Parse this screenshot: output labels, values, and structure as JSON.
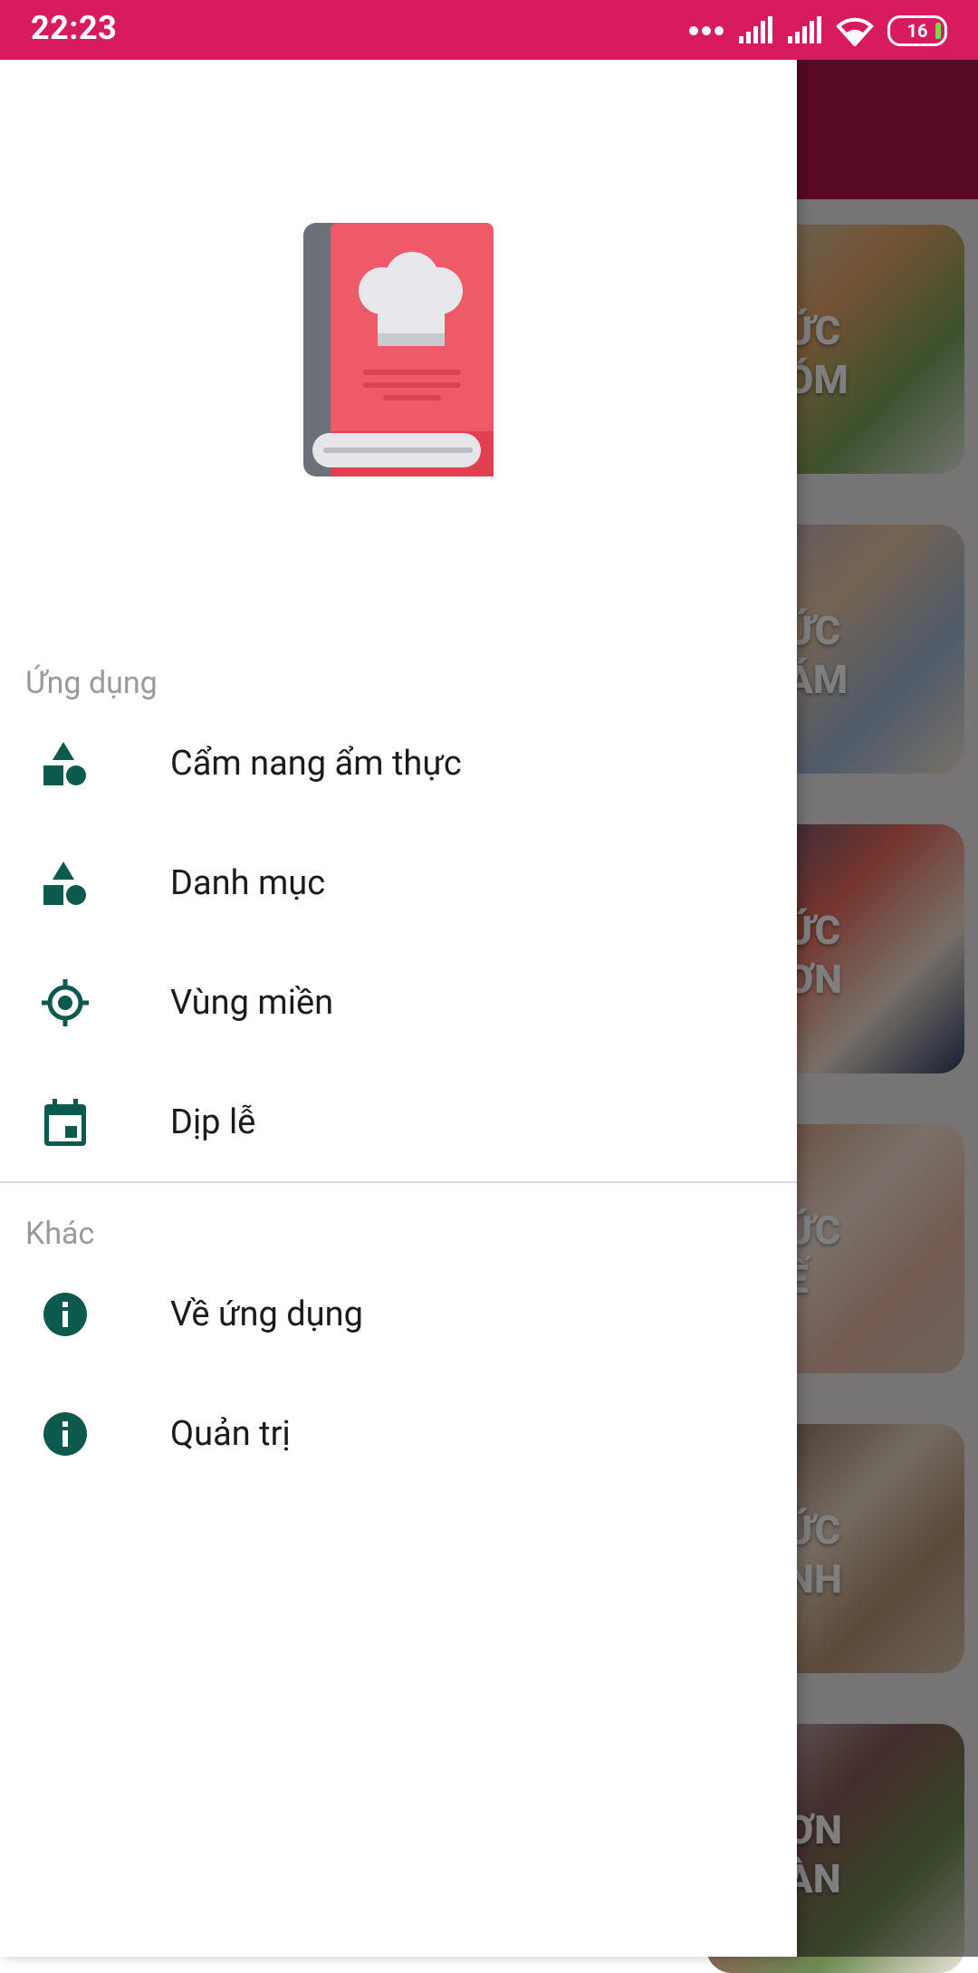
{
  "status_bar": {
    "time": "22:23",
    "battery": "16"
  },
  "background": {
    "cards": [
      {
        "line1": "ỨC",
        "line2": "ÓM"
      },
      {
        "line1": "ỨC",
        "line2": "ÁM"
      },
      {
        "line1": "ỨC",
        "line2": "ƠN"
      },
      {
        "line1": "ỨC",
        "line2": "Ế"
      },
      {
        "line1": "ỨC",
        "line2": "NH"
      },
      {
        "line1": "ƠN",
        "line2": "ÀN"
      }
    ]
  },
  "drawer": {
    "logo_icon": "cookbook-chef-hat-icon",
    "sections": [
      {
        "title": "Ứng dụng",
        "items": [
          {
            "label": "Cẩm nang ẩm thực",
            "icon": "shapes-icon"
          },
          {
            "label": "Danh mục",
            "icon": "shapes-icon"
          },
          {
            "label": "Vùng miền",
            "icon": "location-target-icon"
          },
          {
            "label": "Dịp lễ",
            "icon": "calendar-icon"
          }
        ]
      },
      {
        "title": "Khác",
        "items": [
          {
            "label": "Về ứng dụng",
            "icon": "info-icon"
          },
          {
            "label": "Quản trị",
            "icon": "info-icon"
          }
        ]
      }
    ]
  },
  "colors": {
    "status_bar": "#d81b60",
    "toolbar": "#b0124c",
    "icon": "#0b5a4d",
    "book_cover": "#ef5a68",
    "book_spine": "#6b7079"
  }
}
